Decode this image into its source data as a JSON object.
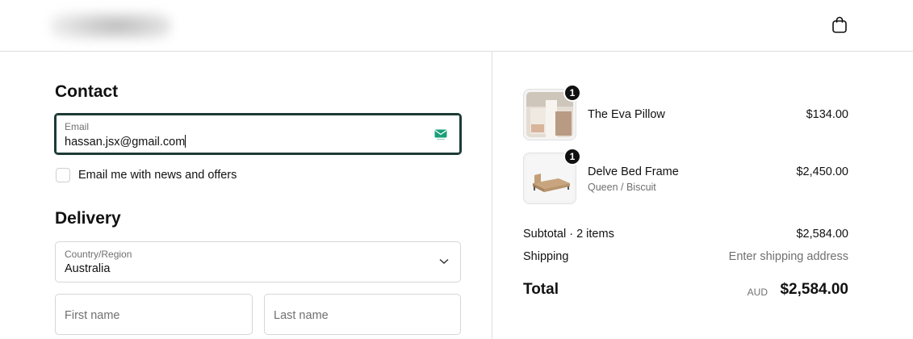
{
  "header": {
    "cart_icon": "shopping-bag-icon"
  },
  "contact": {
    "heading": "Contact",
    "email": {
      "label": "Email",
      "value": "hassan.jsx@gmail.com",
      "icon": "email-verify-icon"
    },
    "newsletter_label": "Email me with news and offers",
    "newsletter_checked": false
  },
  "delivery": {
    "heading": "Delivery",
    "country": {
      "label": "Country/Region",
      "value": "Australia"
    },
    "first_name_placeholder": "First name",
    "last_name_placeholder": "Last name"
  },
  "order": {
    "items": [
      {
        "name": "The Eva Pillow",
        "variant": "",
        "price": "$134.00",
        "quantity": "1"
      },
      {
        "name": "Delve Bed Frame",
        "variant": "Queen / Biscuit",
        "price": "$2,450.00",
        "quantity": "1"
      }
    ],
    "subtotal_label": "Subtotal · 2 items",
    "subtotal_value": "$2,584.00",
    "shipping_label": "Shipping",
    "shipping_value": "Enter shipping address",
    "total_label": "Total",
    "total_currency": "AUD",
    "total_value": "$2,584.00"
  },
  "colors": {
    "focus_border": "#1d3a35",
    "accent_green": "#1a9e7a"
  }
}
